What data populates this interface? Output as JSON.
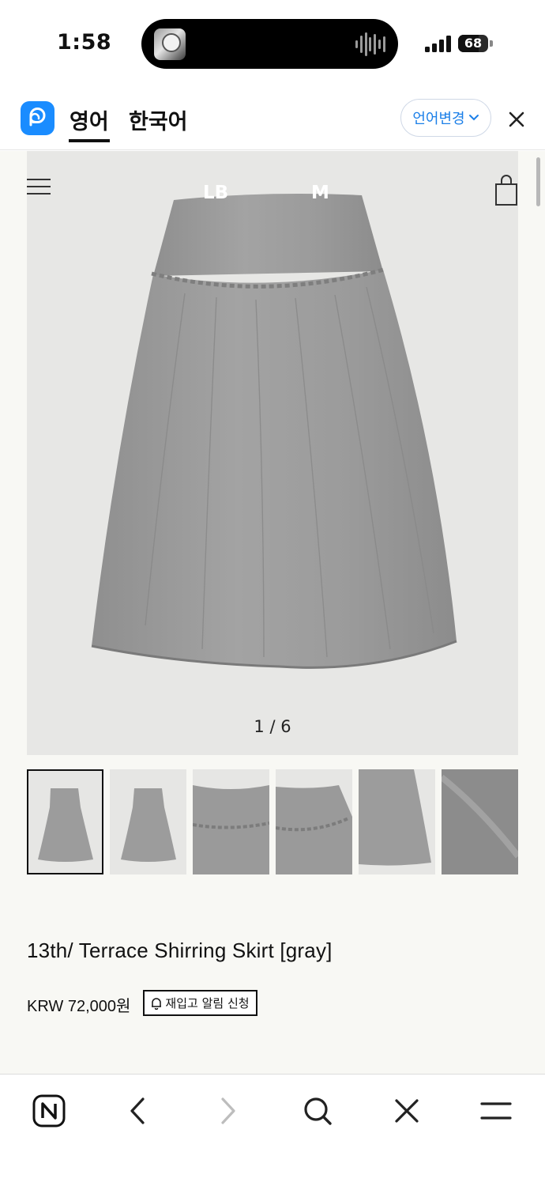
{
  "status_bar": {
    "time": "1:58",
    "battery_level": "68"
  },
  "translate_bar": {
    "logo_icon": "papago-logo-icon",
    "tabs": [
      {
        "label": "영어",
        "selected": true
      },
      {
        "label": "한국어",
        "selected": false
      }
    ],
    "lang_change_label": "언어변경",
    "close_icon": "close-icon"
  },
  "site_header": {
    "menu_icon": "hamburger-menu-icon",
    "brand_left": "LB",
    "brand_right": "M",
    "cart_icon": "shopping-bag-icon"
  },
  "gallery": {
    "counter": "1 / 6",
    "current": 1,
    "total": 6,
    "thumbnails": [
      "skirt-front",
      "skirt-back",
      "waist-detail",
      "shirring-detail",
      "hem-detail",
      "fabric-texture"
    ]
  },
  "product": {
    "title": "13th/ Terrace Shirring Skirt [gray]",
    "price": "KRW 72,000원",
    "restock_label": "재입고 알림 신청",
    "restock_icon": "bell-icon"
  },
  "bottom_nav": {
    "items": [
      "naver-home-icon",
      "back-icon",
      "forward-icon",
      "search-icon",
      "close-icon",
      "menu-icon"
    ]
  },
  "colors": {
    "accent_blue": "#1b7fe8",
    "papago_blue": "#1a8cff",
    "page_bg": "#f8f8f4",
    "hero_bg": "#e7e7e5",
    "skirt_gray": "#9a9a9a"
  }
}
